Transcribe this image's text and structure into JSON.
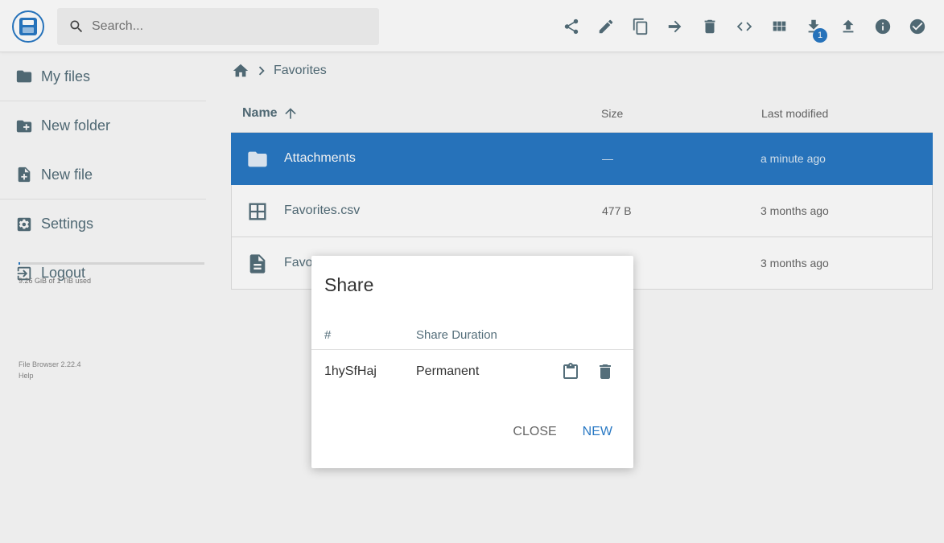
{
  "app": {
    "name": "File Browser",
    "version": "File Browser 2.22.4",
    "help": "Help"
  },
  "search": {
    "placeholder": "Search..."
  },
  "toolbar": {
    "buttons": [
      "share-icon",
      "edit-icon",
      "copy-icon",
      "move-icon",
      "delete-icon",
      "embed-icon",
      "grid-view-icon",
      "download-icon",
      "upload-icon",
      "info-icon",
      "select-icon"
    ],
    "download_badge": "1"
  },
  "sidebar": {
    "items": [
      {
        "label": "My files",
        "icon": "folder-icon"
      },
      {
        "label": "New folder",
        "icon": "new-folder-icon"
      },
      {
        "label": "New file",
        "icon": "new-file-icon"
      },
      {
        "label": "Settings",
        "icon": "settings-icon"
      },
      {
        "label": "Logout",
        "icon": "logout-icon"
      }
    ],
    "quota": {
      "used_text": "9.26 GiB of 1 TiB used",
      "fraction": 0.009
    }
  },
  "breadcrumb": {
    "current": "Favorites"
  },
  "list": {
    "headers": {
      "name": "Name",
      "size": "Size",
      "modified": "Last modified"
    },
    "rows": [
      {
        "name": "Attachments",
        "size": "—",
        "modified": "a minute ago",
        "icon": "folder-icon",
        "selected": true
      },
      {
        "name": "Favorites.csv",
        "size": "477 B",
        "modified": "3 months ago",
        "icon": "table-icon",
        "selected": false
      },
      {
        "name": "Favo",
        "size": "",
        "modified": "3 months ago",
        "icon": "document-icon",
        "selected": false
      }
    ]
  },
  "dialog": {
    "title": "Share",
    "headers": {
      "hash": "#",
      "duration": "Share Duration"
    },
    "shares": [
      {
        "hash": "1hySfHaj",
        "duration": "Permanent"
      }
    ],
    "close_label": "CLOSE",
    "new_label": "NEW"
  },
  "colors": {
    "accent": "#2979c4",
    "icon": "#546e7a"
  }
}
